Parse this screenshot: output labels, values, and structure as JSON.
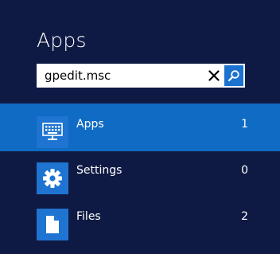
{
  "header": {
    "title": "Apps"
  },
  "search": {
    "value": "gpedit.msc",
    "clear_icon": "close-icon",
    "submit_icon": "search-icon"
  },
  "results": [
    {
      "label": "Apps",
      "count": "1",
      "icon": "keyboard-icon",
      "selected": true
    },
    {
      "label": "Settings",
      "count": "0",
      "icon": "gear-icon",
      "selected": false
    },
    {
      "label": "Files",
      "count": "2",
      "icon": "document-icon",
      "selected": false
    }
  ],
  "colors": {
    "background": "#0f1a44",
    "selected_row": "#0f6bc4",
    "icon_tile": "#1e74d0",
    "search_button": "#1c72cf"
  }
}
